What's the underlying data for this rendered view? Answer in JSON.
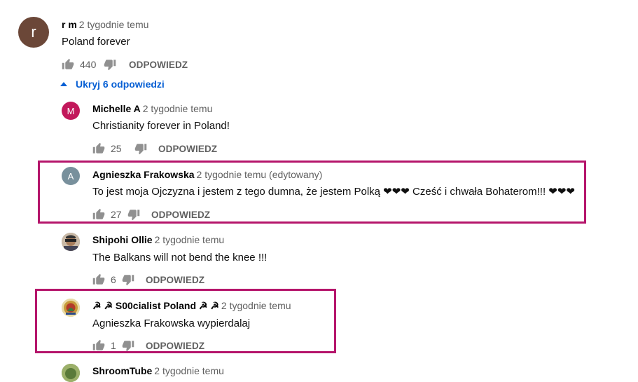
{
  "comments": [
    {
      "author": "r m",
      "time": "2 tygodnie temu",
      "text": "Poland forever",
      "likes": "440",
      "reply": "ODPOWIEDZ",
      "avatar_letter": "r",
      "avatar_color": "#6b4738"
    },
    {
      "author": "Michelle A",
      "time": "2 tygodnie temu",
      "text": "Christianity forever in Poland!",
      "likes": "25",
      "reply": "ODPOWIEDZ",
      "avatar_letter": "M",
      "avatar_color": "#c2185b"
    },
    {
      "author": "Agnieszka Frakowska",
      "time": "2 tygodnie temu (edytowany)",
      "text": "To jest moja Ojczyzna i jestem z tego dumna, że jestem Polką ❤❤❤ Cześć i chwała Bohaterom!!! ❤❤❤",
      "likes": "27",
      "reply": "ODPOWIEDZ",
      "avatar_letter": "A",
      "avatar_color": "#78909c"
    },
    {
      "author": "Shipohi Ollie",
      "time": "2 tygodnie temu",
      "text": "The Balkans will not bend the knee !!!",
      "likes": "6",
      "reply": "ODPOWIEDZ"
    },
    {
      "author": "☭ ☭ S00cialist Poland ☭ ☭",
      "time": "2 tygodnie temu",
      "text": "Agnieszka Frakowska wypierdalaj",
      "likes": "1",
      "reply": "ODPOWIEDZ"
    },
    {
      "author": "ShroomTube",
      "time": "2 tygodnie temu"
    }
  ],
  "replies_toggle": "Ukryj 6 odpowiedzi",
  "colors": {
    "highlight": "#b5156b",
    "link": "#065fd4"
  }
}
